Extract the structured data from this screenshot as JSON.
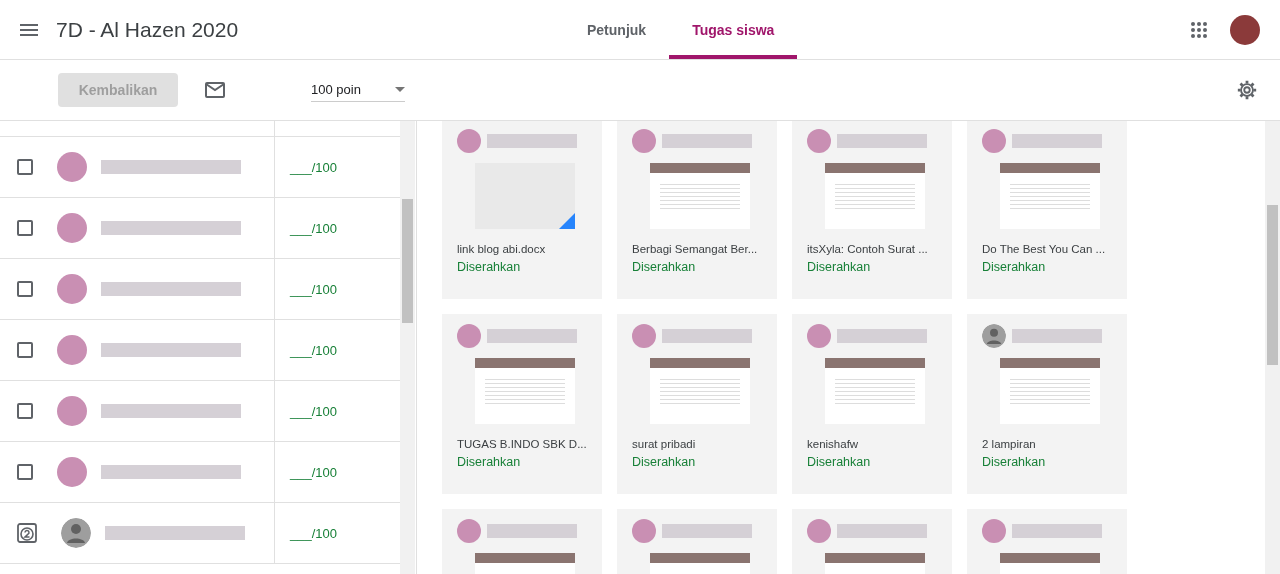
{
  "header": {
    "title": "7D - Al Hazen 2020",
    "tabs": [
      {
        "label": "Petunjuk",
        "selected": false
      },
      {
        "label": "Tugas siswa",
        "selected": true
      }
    ]
  },
  "toolbar": {
    "return_button": {
      "label": "Kembalikan",
      "disabled": true
    },
    "points": {
      "value": "100 poin"
    }
  },
  "students": [
    {
      "kind": "checkbox",
      "checked": false,
      "avatar": {
        "kind": "photo"
      },
      "score": "___/100"
    },
    {
      "kind": "checkbox",
      "checked": false,
      "avatar": {
        "kind": "photo"
      },
      "score": "___/100"
    },
    {
      "kind": "checkbox",
      "checked": false,
      "avatar": {
        "kind": "photo"
      },
      "score": "___/100"
    },
    {
      "kind": "checkbox",
      "checked": false,
      "avatar": {
        "kind": "photo"
      },
      "score": "___/100"
    },
    {
      "kind": "checkbox",
      "checked": false,
      "avatar": {
        "kind": "photo"
      },
      "score": "___/100"
    },
    {
      "kind": "checkbox",
      "checked": false,
      "avatar": {
        "kind": "photo"
      },
      "score": "___/100"
    },
    {
      "kind": "numbered",
      "checked": false,
      "avatar": {
        "kind": "default"
      },
      "score": "___/100"
    }
  ],
  "submissions": [
    {
      "avatar": {
        "kind": "photo"
      },
      "thumbnail": {
        "kind": "file"
      },
      "title": "link blog abi.docx",
      "status": "Diserahkan"
    },
    {
      "avatar": {
        "kind": "photo"
      },
      "thumbnail": {
        "kind": "page"
      },
      "title": "Berbagi Semangat Ber...",
      "status": "Diserahkan"
    },
    {
      "avatar": {
        "kind": "photo"
      },
      "thumbnail": {
        "kind": "page"
      },
      "title": "itsXyla: Contoh Surat ...",
      "status": "Diserahkan"
    },
    {
      "avatar": {
        "kind": "photo"
      },
      "thumbnail": {
        "kind": "page"
      },
      "title": "Do The Best You Can ...",
      "status": "Diserahkan"
    },
    {
      "avatar": {
        "kind": "photo"
      },
      "thumbnail": {
        "kind": "page"
      },
      "title": "TUGAS B.INDO SBK D...",
      "status": "Diserahkan"
    },
    {
      "avatar": {
        "kind": "photo"
      },
      "thumbnail": {
        "kind": "page"
      },
      "title": "surat pribadi",
      "status": "Diserahkan"
    },
    {
      "avatar": {
        "kind": "photo"
      },
      "thumbnail": {
        "kind": "page"
      },
      "title": "kenishafw",
      "status": "Diserahkan"
    },
    {
      "avatar": {
        "kind": "default"
      },
      "thumbnail": {
        "kind": "page"
      },
      "title": "2 lampiran",
      "status": "Diserahkan"
    },
    {
      "avatar": {
        "kind": "photo"
      },
      "thumbnail": {
        "kind": "page"
      }
    },
    {
      "avatar": {
        "kind": "photo"
      },
      "thumbnail": {
        "kind": "page"
      }
    },
    {
      "avatar": {
        "kind": "photo"
      },
      "thumbnail": {
        "kind": "page"
      }
    },
    {
      "avatar": {
        "kind": "photo"
      },
      "thumbnail": {
        "kind": "page"
      }
    }
  ]
}
